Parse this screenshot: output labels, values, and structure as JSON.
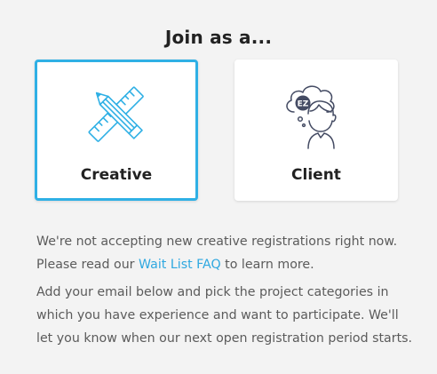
{
  "heading": "Join as a...",
  "cards": {
    "creative": {
      "label": "Creative",
      "selected": true
    },
    "client": {
      "label": "Client",
      "selected": false,
      "badge": "EZ"
    }
  },
  "notice": {
    "line1": "We're not accepting new creative registrations right now.",
    "before_link": "Please read our ",
    "link": "Wait List FAQ",
    "after_link": " to learn more."
  },
  "instructions": "Add your email below and pick the project categories in which you have experience and want to participate. We'll let you know when our next open registration period starts.",
  "colors": {
    "accent": "#2fb0e5",
    "link": "#2fa8e0",
    "background": "#f3f3f3",
    "icon_stroke": "#444b63"
  },
  "icons": {
    "creative": "pencil-ruler-icon",
    "client": "person-thinking-icon"
  }
}
